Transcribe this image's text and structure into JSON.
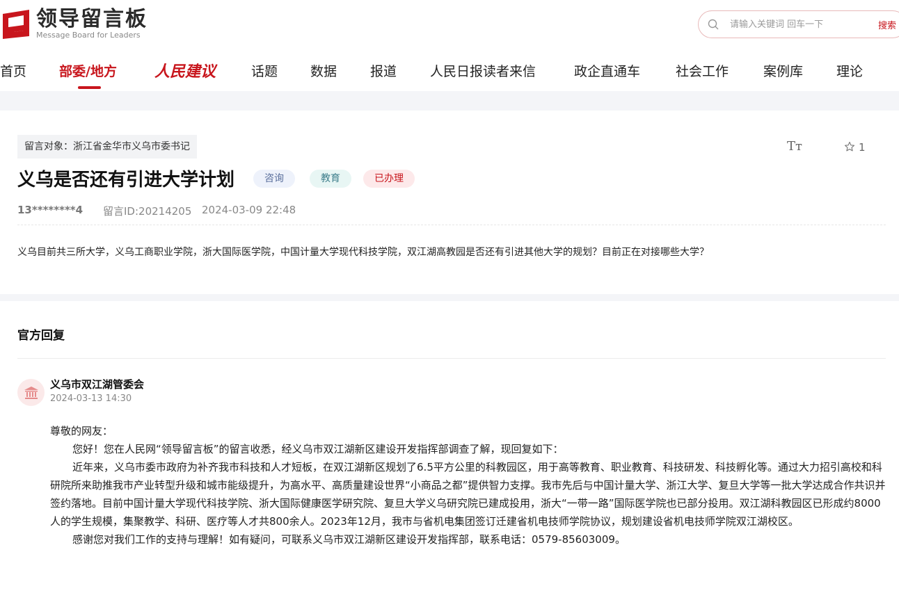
{
  "header": {
    "logo_cn": "领导留言板",
    "logo_en": "Message Board for Leaders",
    "search_placeholder": "请输入关键词 回车一下",
    "search_button": "搜索"
  },
  "nav": {
    "items": [
      "首页",
      "部委/地方",
      "人民建议",
      "话题",
      "数据",
      "报道",
      "人民日报读者来信",
      "政企直通车",
      "社会工作",
      "案例库",
      "理论"
    ],
    "active_index": 1
  },
  "message": {
    "target": "留言对象：浙江省金华市义乌市委书记",
    "title": "义乌是否还有引进大学计划",
    "badges": [
      "咨询",
      "教育",
      "已办理"
    ],
    "user": "13********4",
    "id": "留言ID:20214205",
    "time": "2024-03-09 22:48",
    "font_toggle": "Tт",
    "favorite_count": "1",
    "content": "义乌目前共三所大学，义乌工商职业学院，浙大国际医学院，中国计量大学现代科技学院，双江湖高教园是否还有引进其他大学的规划？目前正在对接哪些大学？"
  },
  "reply": {
    "section_title": "官方回复",
    "org": "义乌市双江湖管委会",
    "time": "2024-03-13 14:30",
    "greeting": "尊敬的网友：",
    "p1": "您好！您在人民网“领导留言板”的留言收悉，经义乌市双江湖新区建设开发指挥部调查了解，现回复如下：",
    "p2": "近年来，义乌市委市政府为补齐我市科技和人才短板，在双江湖新区规划了6.5平方公里的科教园区，用于高等教育、职业教育、科技研发、科技孵化等。通过大力招引高校和科研院所来助推我市产业转型升级和城市能级提升，为高水平、高质量建设世界“小商品之都”提供智力支撑。我市先后与中国计量大学、浙江大学、复旦大学等一批大学达成合作共识并签约落地。目前中国计量大学现代科技学院、浙大国际健康医学研究院、复旦大学义乌研究院已建成投用，浙大“一带一路”国际医学院也已部分投用。双江湖科教园区已形成约8000人的学生规模，集聚教学、科研、医疗等人才共800余人。2023年12月，我市与省机电集团签订迁建省机电技师学院协议，规划建设省机电技师学院双江湖校区。",
    "p3": "感谢您对我们工作的支持与理解！如有疑问，可联系义乌市双江湖新区建设开发指挥部，联系电话：0579-85603009。"
  },
  "colors": {
    "brand_red": "#c8161d",
    "band_gray": "#f4f5f8"
  }
}
